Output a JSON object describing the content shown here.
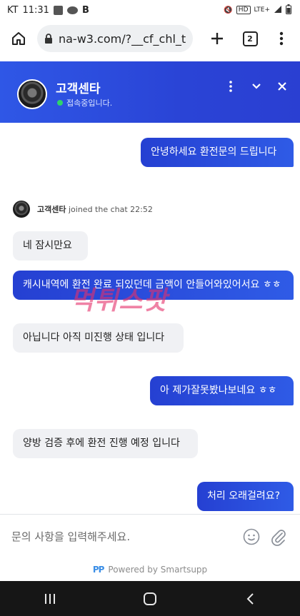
{
  "status_bar": {
    "carrier": "KT",
    "time": "11:31",
    "talk_badge": "TALK",
    "blog_badge": "B",
    "network": "LTE+",
    "hd_label": "HD"
  },
  "browser": {
    "url": "na-w3.com/?__cf_chl_t",
    "tab_count": "2",
    "icons": [
      "home-icon",
      "lock-icon",
      "plus-icon",
      "tabs-icon",
      "menu-icon"
    ]
  },
  "chat_header": {
    "title": "고객센타",
    "status": "접속중입니다.",
    "status_color": "#2fd36b",
    "background": "#2a44d6"
  },
  "messages": [
    {
      "side": "out",
      "text": "안녕하세요 환전문의 드립니다"
    },
    {
      "side": "in",
      "text": "네 잠시만요"
    },
    {
      "side": "out",
      "text": "캐시내역에 환전 완료 되있던데 금액이 안들어와있어서요 ㅎㅎ"
    },
    {
      "side": "in",
      "text": "아닙니다 아직 미진행 상태 입니다"
    },
    {
      "side": "out",
      "text": "아 제가잘못봤나보네요 ㅎㅎ"
    },
    {
      "side": "in",
      "text": "양방 검증 후에 환전 진행 예정 입니다"
    },
    {
      "side": "out",
      "text": "처리 오래걸려요?"
    }
  ],
  "joined_notice": {
    "name": "고객센타",
    "text": "joined the chat 22:52"
  },
  "watermark": "먹튀스팟",
  "composer": {
    "placeholder": "문의 사항을 입력해주세요."
  },
  "footer": {
    "logo": "PP",
    "powered_by": "Powered by Smartsupp"
  }
}
